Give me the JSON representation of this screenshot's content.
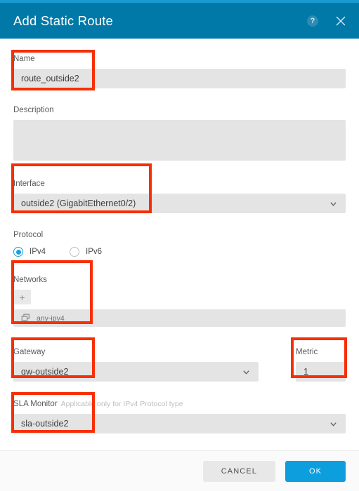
{
  "dialog": {
    "title": "Add Static Route",
    "help_icon": "help-circle-icon",
    "close_icon": "close-icon",
    "header_color": "#0079a8",
    "accent_color": "#0d9edd",
    "annotation_color": "#f62f06"
  },
  "fields": {
    "name": {
      "label": "Name",
      "value": "route_outside2",
      "placeholder": ""
    },
    "description": {
      "label": "Description",
      "value": "",
      "placeholder": ""
    },
    "interface": {
      "label": "Interface",
      "value": "outside2 (GigabitEthernet0/2)",
      "chevron_icon": "chevron-down-icon"
    },
    "protocol": {
      "label": "Protocol",
      "options": [
        {
          "label": "IPv4",
          "selected": true
        },
        {
          "label": "IPv6",
          "selected": false
        }
      ]
    },
    "networks": {
      "label": "Networks",
      "add_label": "+",
      "items": [
        {
          "icon": "network-object-icon",
          "name": "any-ipv4"
        }
      ]
    },
    "gateway": {
      "label": "Gateway",
      "value": "gw-outside2",
      "chevron_icon": "chevron-down-icon"
    },
    "metric": {
      "label": "Metric",
      "value": "1"
    },
    "sla_monitor": {
      "label": "SLA Monitor",
      "hint": "Applicable only for IPv4 Protocol type",
      "value": "sla-outside2",
      "chevron_icon": "chevron-down-icon"
    }
  },
  "footer": {
    "cancel_label": "CANCEL",
    "ok_label": "OK"
  }
}
